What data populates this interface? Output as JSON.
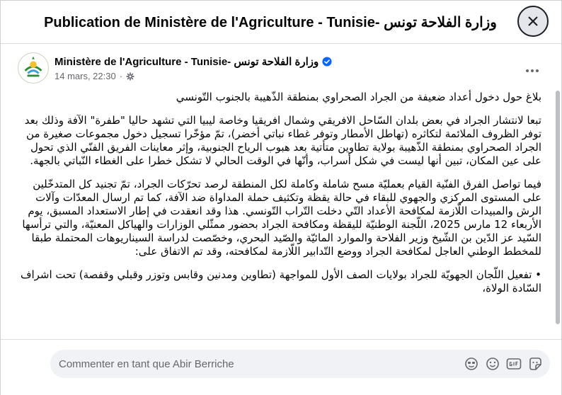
{
  "header": {
    "title": "Publication de Ministère de l'Agriculture - Tunisie- وزارة الفلاحة تونس"
  },
  "post": {
    "author": "Ministère de l'Agriculture - Tunisie- وزارة الفلاحة تونس",
    "timestamp": "14 mars, 22:30",
    "paragraphs": [
      "بلاغ حول دخول أعداد ضعيفة من الجراد الصحراوي بمنطقة الذّهيبة بالجنوب التّونسي",
      "تبعا لانتشار الجراد في بعض بلدان السّاحل الافريقي وشمال افريقيا وخاصة ليبيا التي تشهد حاليا \"طفرة\" الآفة وذلك بعد توفر الظروف الملائمة لتكاثره (تهاطل الأمطار وتوفر غطاء نباتي أخضر)، تمّ مؤخّرا تسجيل دخول مجموعات صغيرة من الجراد الصحراوي بمنطقة الذّهيبة بولاية تطاوين متأتية بعد هبوب الرياح الجنوبية، وإثر معاينات الفريق الفنّي الذي تحول على عين المكان، تبين أنها ليست في شكل أسراب، وأنّها في الوقت الحالي لا تشكل خطرا على الغطاء النّباتي بالجهة.",
      "فيما تواصل الفرق الفنّية القيام بعمليّة مسح شاملة وكاملة لكل المنطقة لرصد تحرّكات الجراد، تمّ تجنيد كل المتدخّلين على المستوى المركزي والجهوي للبقاء في حالة يقظة وتكثيف حملة المداواة ضد الآفة، كما تم ارسال المعدّات وآلات الرش والمبيدات اللّازمة لمكافحة الأعداد التّي دخلت التّراب التّونسي. هذا وقد انعقدت في إطار الاستعداد المسبق، يوم الأربعاء 12 مارس 2025، اللّجنة الوطنيّة لليقظة ومكافحة الجراد بحضور ممثّلي الوزارات والهياكل المعنيّة، والتي ترأسها السّيد عز الدّين بن الشّيخ وزير الفلاحة والموارد المائيّة والصّيد البحري، وخصّصت لدراسة السيناريوهات المحتملة طبقا للمخطط الوطني العاجل لمكافحة الجراد ووضع التّدابير اللّازمة لمكافحته، وقد تم الاتفاق على:",
      "• تفعيل اللّجان الجهويّة للجراد بولايات الصف الأول للمواجهة (تطاوين ومدنين وقابس وتوزر وقبلي وقفصة) تحت اشراف السّادة الولاة،"
    ]
  },
  "comment": {
    "placeholder": "Commenter en tant que Abir Berriche"
  },
  "icons": {
    "close": "close-icon",
    "verified": "verified-badge-icon",
    "privacy": "gear-icon",
    "more": "more-options-icon",
    "avatar_emoji": "avatar-emoji-icon",
    "emoji": "emoji-icon",
    "gif": "gif-icon",
    "sticker": "sticker-icon"
  },
  "colors": {
    "accent": "#0866ff",
    "secondary_text": "#65676b",
    "input_bg": "#f0f2f5"
  }
}
